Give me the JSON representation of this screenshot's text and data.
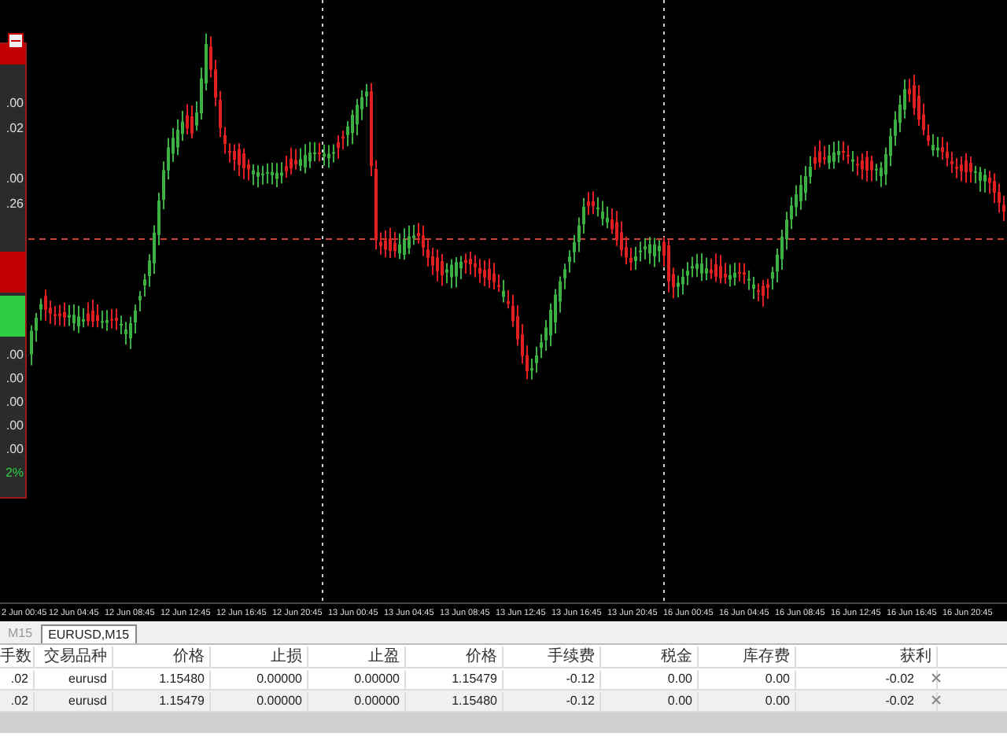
{
  "chart": {
    "side_panel": {
      "values": [
        ".00",
        ".02",
        ".00",
        ".26"
      ],
      "stats": [
        ".00",
        ".00",
        ".00",
        ".00",
        ".00"
      ],
      "percent": "2%"
    },
    "time_axis": [
      "2 Jun 00:45",
      "12 Jun 04:45",
      "12 Jun 08:45",
      "12 Jun 12:45",
      "12 Jun 16:45",
      "12 Jun 20:45",
      "13 Jun 00:45",
      "13 Jun 04:45",
      "13 Jun 08:45",
      "13 Jun 12:45",
      "13 Jun 16:45",
      "13 Jun 20:45",
      "16 Jun 00:45",
      "16 Jun 04:45",
      "16 Jun 08:45",
      "16 Jun 12:45",
      "16 Jun 16:45",
      "16 Jun 20:45"
    ]
  },
  "tabs": [
    {
      "label": "M15",
      "selected": false
    },
    {
      "label": "EURUSD,M15",
      "selected": true
    }
  ],
  "table": {
    "columns": [
      "手数",
      "交易品种",
      "价格",
      "止损",
      "止盈",
      "价格",
      "手续费",
      "税金",
      "库存费",
      "获利"
    ],
    "rows": [
      {
        "cells": [
          ".02",
          "eurusd",
          "1.15480",
          "0.00000",
          "0.00000",
          "1.15479",
          "-0.12",
          "0.00",
          "0.00",
          "-0.02"
        ]
      },
      {
        "cells": [
          ".02",
          "eurusd",
          "1.15479",
          "0.00000",
          "0.00000",
          "1.15480",
          "-0.12",
          "0.00",
          "0.00",
          "-0.02"
        ]
      }
    ]
  }
}
